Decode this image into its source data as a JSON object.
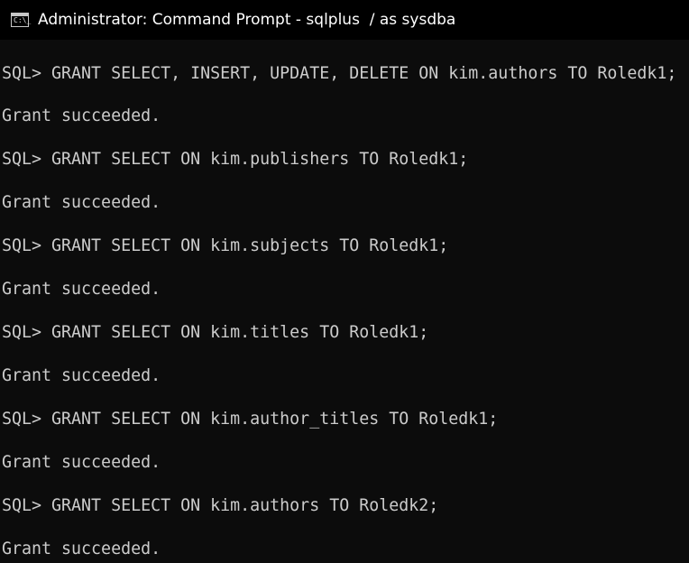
{
  "window": {
    "title": "Administrator: Command Prompt - sqlplus  / as sysdba",
    "icon": "cmd-icon",
    "icon_glyph": "C:\\_"
  },
  "console": {
    "lines": [
      "SQL> GRANT SELECT, INSERT, UPDATE, DELETE ON kim.authors TO Roledk1;",
      "Grant succeeded.",
      "SQL> GRANT SELECT ON kim.publishers TO Roledk1;",
      "Grant succeeded.",
      "SQL> GRANT SELECT ON kim.subjects TO Roledk1;",
      "Grant succeeded.",
      "SQL> GRANT SELECT ON kim.titles TO Roledk1;",
      "Grant succeeded.",
      "SQL> GRANT SELECT ON kim.author_titles TO Roledk1;",
      "Grant succeeded.",
      "SQL> GRANT SELECT ON kim.authors TO Roledk2;",
      "Grant succeeded."
    ]
  },
  "colors": {
    "background": "#0c0c0c",
    "text": "#cccccc",
    "titlebar": "#000000",
    "title_text": "#ffffff"
  }
}
